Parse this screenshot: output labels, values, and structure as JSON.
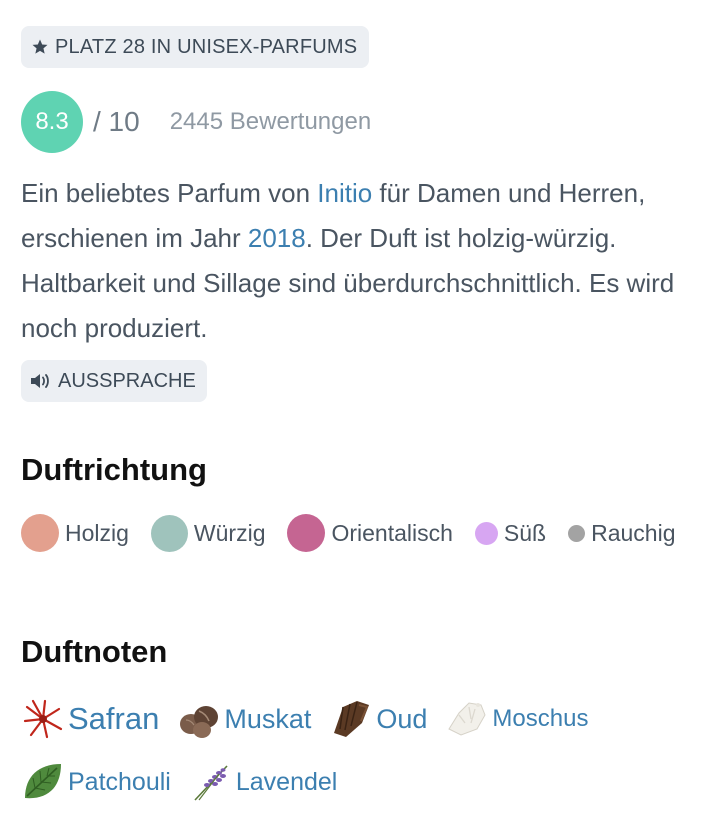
{
  "ranking": {
    "icon": "star-icon",
    "text": "PLATZ 28 IN UNISEX-PARFUMS"
  },
  "rating": {
    "score": "8.3",
    "max": "/ 10",
    "votes": "2445 Bewertungen",
    "score_color": "#5fd3b2"
  },
  "description": {
    "part1": "Ein beliebtes Parfum von ",
    "brand": "Initio",
    "part2": " für Damen und Herren, erschienen im Jahr ",
    "year": "2018",
    "part3": ". Der Duft ist holzig-würzig. Haltbarkeit und Sillage sind überdurchschnittlich. Es wird noch produziert."
  },
  "pronunciation": {
    "icon": "speaker-icon",
    "label": "AUSSPRACHE"
  },
  "accords_section": {
    "title": "Duftrichtung",
    "items": [
      {
        "label": "Holzig",
        "color": "#e3a08e"
      },
      {
        "label": "Würzig",
        "color": "#9fc3bc"
      },
      {
        "label": "Orientalisch",
        "color": "#c56592"
      },
      {
        "label": "Süß",
        "color": "#d7a6f2"
      },
      {
        "label": "Rauchig",
        "color": "#a3a3a3"
      }
    ]
  },
  "notes_section": {
    "title": "Duftnoten",
    "items": [
      {
        "label": "Safran",
        "icon": "saffron-icon"
      },
      {
        "label": "Muskat",
        "icon": "nutmeg-icon"
      },
      {
        "label": "Oud",
        "icon": "oud-wood-icon"
      },
      {
        "label": "Moschus",
        "icon": "musk-icon"
      },
      {
        "label": "Patchouli",
        "icon": "patchouli-leaf-icon"
      },
      {
        "label": "Lavendel",
        "icon": "lavender-icon"
      }
    ]
  }
}
